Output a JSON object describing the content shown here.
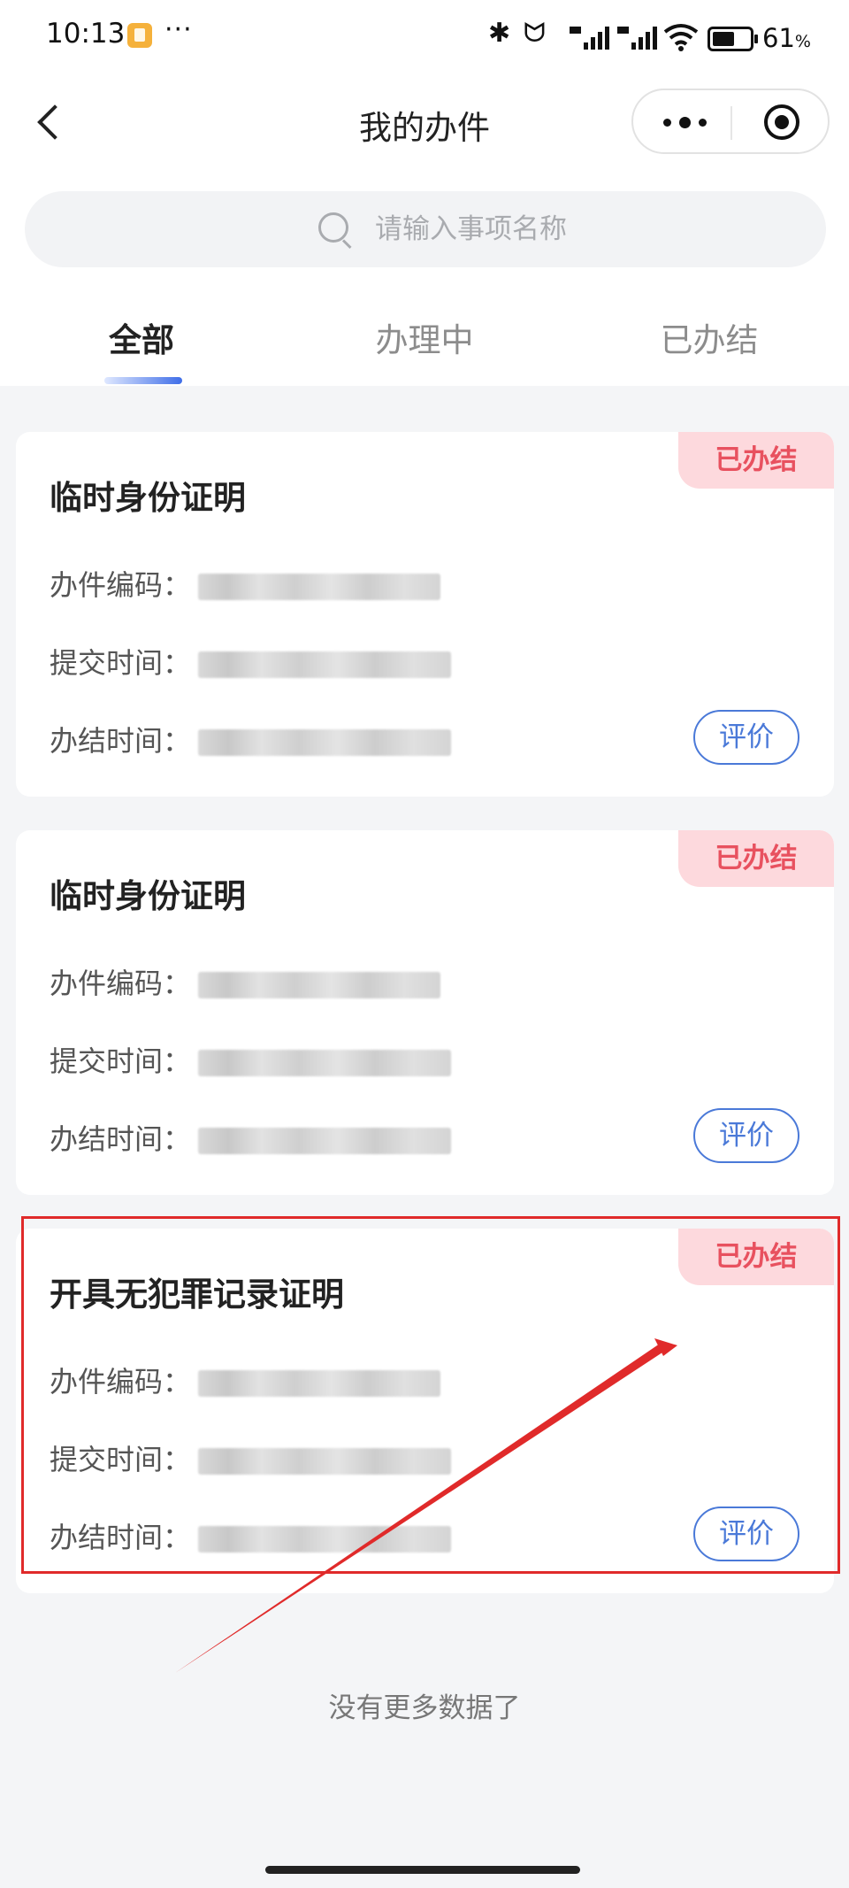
{
  "status_bar": {
    "time": "10:13",
    "more_dots": "···",
    "icons": [
      "bluetooth-icon",
      "headphones-icon",
      "hd-signal-icon",
      "hd-signal-icon",
      "wifi-icon",
      "battery-icon"
    ],
    "battery_percent": "61",
    "battery_unit": "%"
  },
  "nav": {
    "title": "我的办件"
  },
  "search": {
    "placeholder": "请输入事项名称"
  },
  "tabs": [
    {
      "label": "全部",
      "active": true
    },
    {
      "label": "办理中",
      "active": false
    },
    {
      "label": "已办结",
      "active": false
    }
  ],
  "field_labels": {
    "code": "办件编码：",
    "submit_time": "提交时间：",
    "complete_time": "办结时间："
  },
  "cards": [
    {
      "title": "临时身份证明",
      "status": "已办结",
      "rate_label": "评价"
    },
    {
      "title": "临时身份证明",
      "status": "已办结",
      "rate_label": "评价"
    },
    {
      "title": "开具无犯罪记录证明",
      "status": "已办结",
      "rate_label": "评价"
    }
  ],
  "footer": "没有更多数据了",
  "colors": {
    "accent": "#4a79d8",
    "status_text": "#e8515f",
    "status_bg": "#fdd9dd",
    "highlight": "#e02a2a"
  }
}
